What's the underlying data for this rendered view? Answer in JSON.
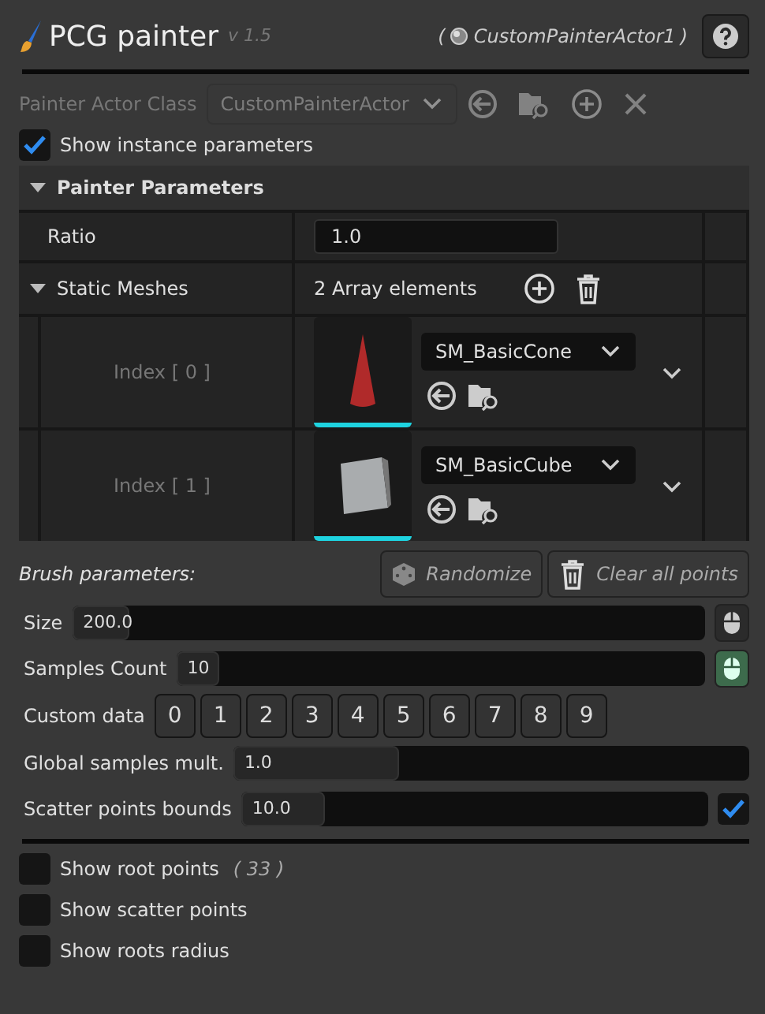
{
  "header": {
    "title": "PCG painter",
    "version": "v 1.5",
    "actor_open": "(",
    "actor": "CustomPainterActor1",
    "actor_close": ")"
  },
  "painter_actor_class": {
    "label": "Painter Actor Class",
    "value": "CustomPainterActor",
    "disabled": true
  },
  "show_instance_parameters": {
    "label": "Show instance parameters",
    "checked": true
  },
  "painter_parameters": {
    "title": "Painter Parameters",
    "expanded": true,
    "ratio": {
      "label": "Ratio",
      "value": "1.0"
    },
    "static_meshes": {
      "label": "Static Meshes",
      "expanded": true,
      "summary": "2 Array elements",
      "elements": [
        {
          "label": "Index [ 0 ]",
          "mesh": "SM_BasicCone",
          "kind": "cone"
        },
        {
          "label": "Index [ 1 ]",
          "mesh": "SM_BasicCube",
          "kind": "cube"
        }
      ]
    }
  },
  "brush": {
    "title": "Brush parameters:",
    "buttons": [
      {
        "label": "Randomize",
        "kind": "dice"
      },
      {
        "label": "Clear all points",
        "kind": "trash"
      }
    ],
    "rows": [
      {
        "kind": "slider",
        "label": "Size",
        "value": "200.0",
        "level": 0.09,
        "mouse_toggle": {
          "on": false
        }
      },
      {
        "kind": "slider",
        "label": "Samples Count",
        "value": "10",
        "level": 0.08,
        "mouse_toggle": {
          "on": true
        }
      },
      {
        "kind": "buttons",
        "label": "Custom data",
        "values": [
          "0",
          "1",
          "2",
          "3",
          "4",
          "5",
          "6",
          "7",
          "8",
          "9"
        ]
      },
      {
        "kind": "slider",
        "label": "Global samples mult.",
        "value": "1.0",
        "level": 0.32
      },
      {
        "kind": "slider",
        "label": "Scatter points bounds",
        "value": "10.0",
        "level": 0.18,
        "checkbox": {
          "checked": true
        }
      }
    ]
  },
  "toggles": [
    {
      "label": "Show root points",
      "count": "( 33 )",
      "checked": false
    },
    {
      "label": "Show scatter points",
      "checked": false
    },
    {
      "label": "Show roots radius",
      "checked": false
    }
  ]
}
